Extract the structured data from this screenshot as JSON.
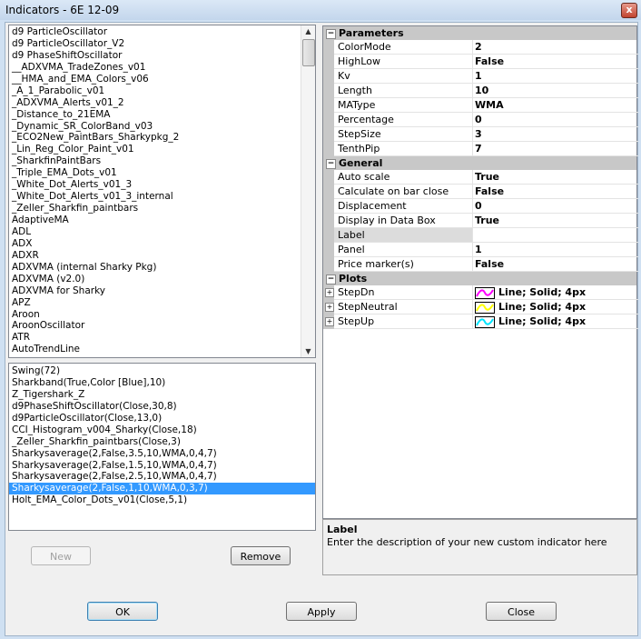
{
  "window": {
    "title": "Indicators - 6E 12-09",
    "close_glyph": "x"
  },
  "available_list": {
    "items": [
      "d9 ParticleOscillator",
      "d9 ParticleOscillator_V2",
      "d9 PhaseShiftOscillator",
      "__ADXVMA_TradeZones_v01",
      "__HMA_and_EMA_Colors_v06",
      "_A_1_Parabolic_v01",
      "_ADXVMA_Alerts_v01_2",
      "_Distance_to_21EMA",
      "_Dynamic_SR_ColorBand_v03",
      "_ECO2New_PaintBars_Sharkypkg_2",
      "_Lin_Reg_Color_Paint_v01",
      "_SharkfinPaintBars",
      "_Triple_EMA_Dots_v01",
      "_White_Dot_Alerts_v01_3",
      "_White_Dot_Alerts_v01_3_internal",
      "_Zeller_Sharkfin_paintbars",
      "AdaptiveMA",
      "ADL",
      "ADX",
      "ADXR",
      "ADXVMA (internal Sharky Pkg)",
      "ADXVMA (v2.0)",
      "ADXVMA for Sharky",
      "APZ",
      "Aroon",
      "AroonOscillator",
      "ATR",
      "AutoTrendLine"
    ]
  },
  "applied_list": {
    "selected_index": 10,
    "items": [
      "Swing(72)",
      "Sharkband(True,Color [Blue],10)",
      "Z_Tigershark_Z",
      "d9PhaseShiftOscillator(Close,30,8)",
      "d9ParticleOscillator(Close,13,0)",
      "CCI_Histogram_v004_Sharky(Close,18)",
      "_Zeller_Sharkfin_paintbars(Close,3)",
      "Sharkysaverage(2,False,3.5,10,WMA,0,4,7)",
      "Sharkysaverage(2,False,1.5,10,WMA,0,4,7)",
      "Sharkysaverage(2,False,2.5,10,WMA,0,4,7)",
      "Sharkysaverage(2,False,1,10,WMA,0,3,7)",
      "Holt_EMA_Color_Dots_v01(Close,5,1)"
    ]
  },
  "buttons": {
    "new": "New",
    "remove": "Remove",
    "ok": "OK",
    "apply": "Apply",
    "close": "Close"
  },
  "grid": {
    "parameters_title": "Parameters",
    "parameters": [
      {
        "name": "ColorMode",
        "value": "2"
      },
      {
        "name": "HighLow",
        "value": "False"
      },
      {
        "name": "Kv",
        "value": "1"
      },
      {
        "name": "Length",
        "value": "10"
      },
      {
        "name": "MAType",
        "value": "WMA"
      },
      {
        "name": "Percentage",
        "value": "0"
      },
      {
        "name": "StepSize",
        "value": "3"
      },
      {
        "name": "TenthPip",
        "value": "7"
      }
    ],
    "general_title": "General",
    "general": [
      {
        "name": "Auto scale",
        "value": "True"
      },
      {
        "name": "Calculate on bar close",
        "value": "False"
      },
      {
        "name": "Displacement",
        "value": "0"
      },
      {
        "name": "Display in Data Box",
        "value": "True"
      },
      {
        "name": "Label",
        "value": ""
      },
      {
        "name": "Panel",
        "value": "1"
      },
      {
        "name": "Price marker(s)",
        "value": "False"
      }
    ],
    "plots_title": "Plots",
    "plots": [
      {
        "name": "StepDn",
        "value": "Line; Solid; 4px",
        "color": "#ff00ff"
      },
      {
        "name": "StepNeutral",
        "value": "Line; Solid; 4px",
        "color": "#ffff00"
      },
      {
        "name": "StepUp",
        "value": "Line; Solid; 4px",
        "color": "#00e5ff"
      }
    ],
    "collapse_glyph": "−",
    "expand_glyph": "+"
  },
  "description": {
    "title": "Label",
    "text": "Enter the description of your new custom indicator here"
  }
}
